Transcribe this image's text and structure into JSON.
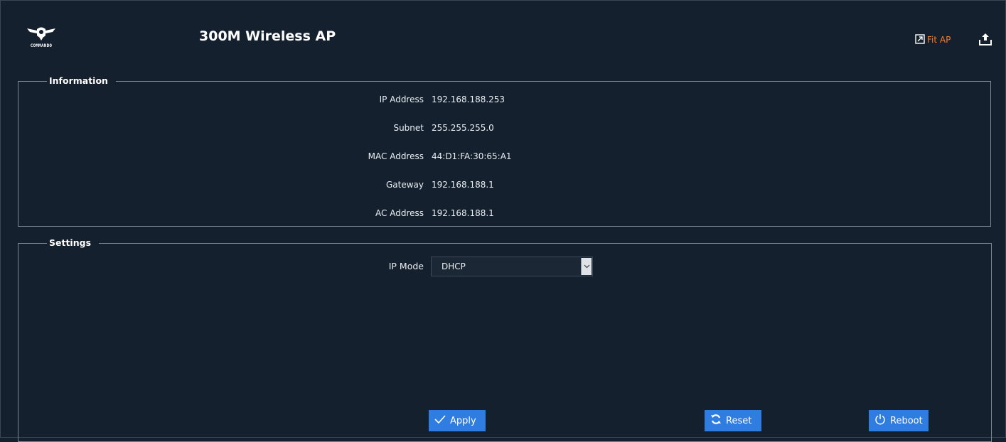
{
  "brand": {
    "logo_text": "COMMANDO",
    "app_title": "300M Wireless AP"
  },
  "header": {
    "fit_ap_label": "Fit AP",
    "fit_ap_color": "#ff7a20"
  },
  "information": {
    "legend": "Information",
    "rows": [
      {
        "label": "IP Address",
        "value": "192.168.188.253"
      },
      {
        "label": "Subnet",
        "value": "255.255.255.0"
      },
      {
        "label": "MAC Address",
        "value": "44:D1:FA:30:65:A1"
      },
      {
        "label": "Gateway",
        "value": "192.168.188.1"
      },
      {
        "label": "AC Address",
        "value": "192.168.188.1"
      }
    ]
  },
  "settings": {
    "legend": "Settings",
    "ip_mode_label": "IP Mode",
    "ip_mode_value": "DHCP"
  },
  "actions": {
    "apply_label": "Apply",
    "reset_label": "Reset",
    "reboot_label": "Reboot",
    "button_color": "#2f7de1"
  }
}
